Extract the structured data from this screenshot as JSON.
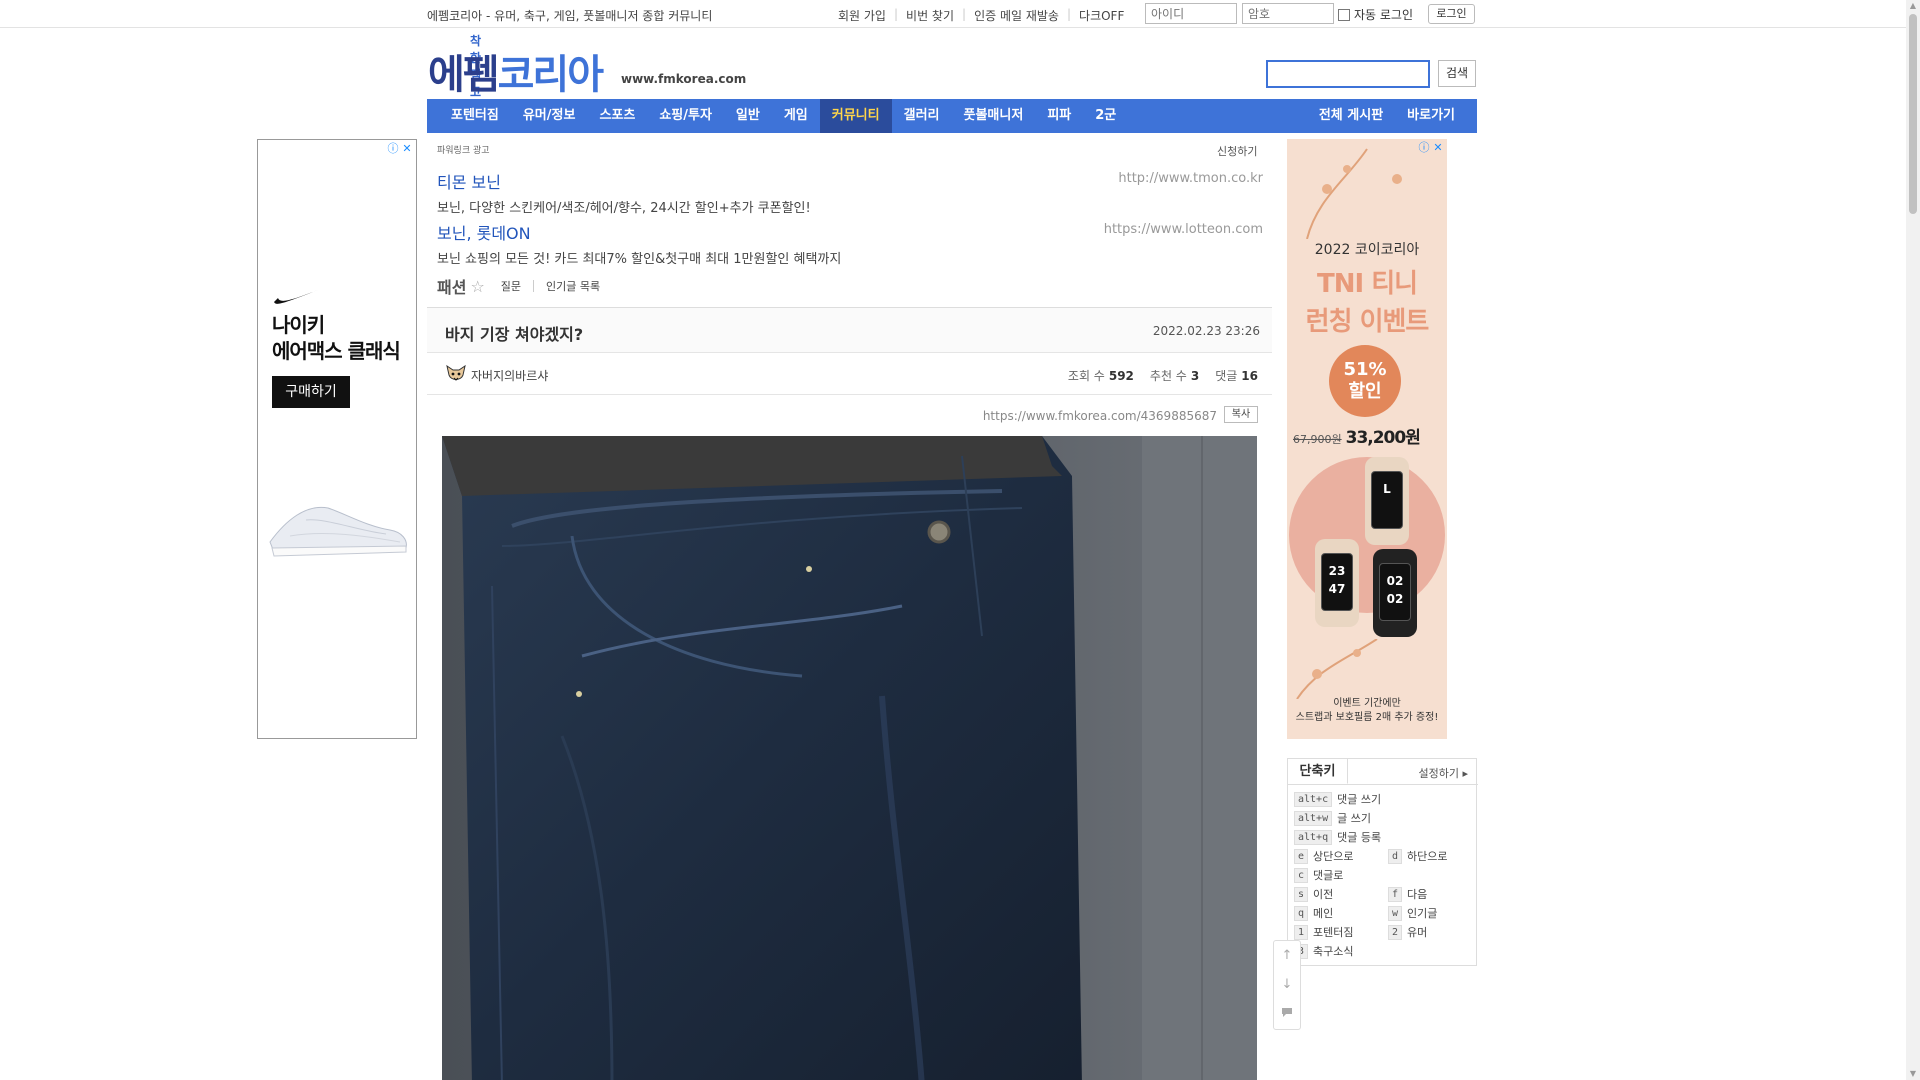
{
  "topbar": {
    "tagline": "에펨코리아 - 유머, 축구, 게임, 풋볼매니저 종합 커뮤니티",
    "links": [
      "회원 가입",
      "비번 찾기",
      "인증 메일 재발송",
      "다크OFF"
    ],
    "id_placeholder": "아이디",
    "pw_placeholder": "암호",
    "autologin_label": "자동 로그인",
    "login_label": "로그인"
  },
  "header": {
    "logo_small": "착한 펨코",
    "logo_part1": "에펨",
    "logo_part2": "코리아",
    "url": "www.fmkorea.com",
    "search_label": "검색"
  },
  "nav": {
    "items": [
      "포텐터짐",
      "유머/정보",
      "스포츠",
      "쇼핑/투자",
      "일반",
      "게임",
      "커뮤니티",
      "갤러리",
      "풋볼매니저",
      "피파",
      "2군"
    ],
    "active_index": 6,
    "right": [
      "전체 게시판",
      "바로가기"
    ]
  },
  "ad_left": {
    "title_line1": "나이키",
    "title_line2": "에어맥스 클래식",
    "button": "구매하기"
  },
  "ad_right": {
    "year": "2022 코이코리아",
    "title_line1": "TNI 티니",
    "title_line2": "런칭 이벤트",
    "badge_line1": "51%",
    "badge_line2": "할인",
    "old_price": "67,900원",
    "new_price": "33,200원",
    "band1_time": "L",
    "band2_time": "23 47",
    "band3_time": "02 02",
    "foot_line1": "이벤트 기간에만",
    "foot_line2": "스트랩과 보호필름 2매 추가 증정!"
  },
  "powerlink": {
    "head": "파워링크 광고",
    "apply": "신청하기",
    "items": [
      {
        "title": "티몬 보닌",
        "desc": "보닌, 다양한 스킨케어/색조/헤어/향수, 24시간 할인+추가 쿠폰할인!",
        "url": "http://www.tmon.co.kr"
      },
      {
        "title": "보닌, 롯데ON",
        "desc": "보닌 쇼핑의 모든 것! 카드 최대7% 할인&첫구매 최대 1만원할인 혜택까지",
        "url": "https://www.lotteon.com"
      }
    ]
  },
  "category": {
    "name": "패션",
    "links": [
      "질문",
      "인기글 목록"
    ]
  },
  "post": {
    "title": "바지 기장 쳐야겠지?",
    "date": "2022.02.23 23:26",
    "author": "자버지의바르샤",
    "views_label": "조회 수",
    "views": "592",
    "votes_label": "추천 수",
    "votes": "3",
    "comments_label": "댓글",
    "comments": "16",
    "url": "https://www.fmkorea.com/4369885687",
    "copy_label": "복사"
  },
  "shortcut": {
    "tab": "단축키",
    "settings": "설정하기",
    "rows": [
      {
        "key": "alt+c",
        "label": "댓글 쓰기"
      },
      {
        "key": "alt+w",
        "label": "글 쓰기"
      },
      {
        "key": "alt+q",
        "label": "댓글 등록"
      }
    ],
    "pairs": [
      {
        "k1": "e",
        "l1": "상단으로",
        "k2": "d",
        "l2": "하단으로"
      },
      {
        "k1": "c",
        "l1": "댓글로",
        "k2": "",
        "l2": ""
      },
      {
        "k1": "s",
        "l1": "이전",
        "k2": "f",
        "l2": "다음"
      },
      {
        "k1": "q",
        "l1": "메인",
        "k2": "w",
        "l2": "인기글"
      },
      {
        "k1": "1",
        "l1": "포텐터짐",
        "k2": "2",
        "l2": "유머"
      },
      {
        "k1": "3",
        "l1": "축구소식",
        "k2": "",
        "l2": ""
      }
    ]
  },
  "colors": {
    "brand_blue": "#3e73d8",
    "nav_active_bg": "#2b4c9c",
    "nav_active_text": "#ffd64a",
    "link_blue": "#2255bb"
  },
  "icons": {
    "float_up": "arrow-up-icon",
    "float_down": "arrow-down-icon",
    "float_comment": "comment-icon"
  }
}
